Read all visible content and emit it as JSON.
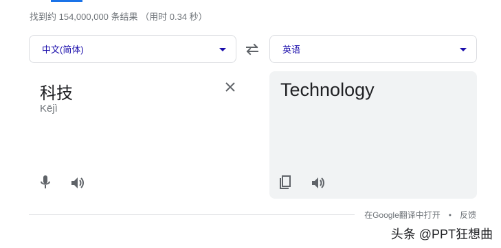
{
  "result_stats": "找到约 154,000,000 条结果 （用时 0.34 秒）",
  "source": {
    "language": "中文(简体)",
    "text": "科技",
    "romanization": "Kējì"
  },
  "target": {
    "language": "英语",
    "text": "Technology"
  },
  "footer": {
    "open_in_translate": "在Google翻译中打开",
    "separator": "•",
    "feedback": "反馈"
  },
  "watermark": "头条 @PPT狂想曲",
  "colors": {
    "accent_blue": "#1a73e8",
    "link_blue": "#1a0dab",
    "icon_gray": "#5f6368",
    "panel_bg": "#f1f3f4"
  },
  "icons": [
    "swap-icon",
    "close-icon",
    "mic-icon",
    "speaker-icon",
    "copy-icon",
    "chevron-down-icon"
  ]
}
